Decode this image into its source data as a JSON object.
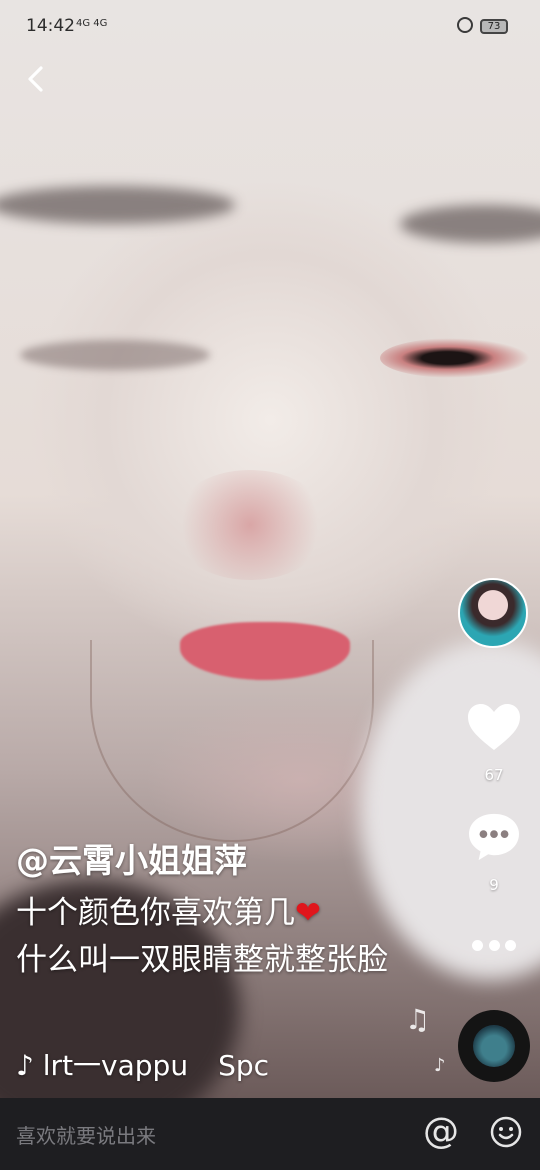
{
  "status_bar": {
    "time": "14:42",
    "signal_text": "4G 4G",
    "battery": "73"
  },
  "author": "@云霄小姐姐萍",
  "description_line1": "十个颜色你喜欢第几",
  "heart_emoji": "❤",
  "description_line2": "什么叫一双眼睛整就整张脸",
  "music": {
    "note": "♪",
    "title": "lrt一vappu",
    "artist": "Spc"
  },
  "actions": {
    "likes": "67",
    "comments": "9"
  },
  "comment_bar": {
    "placeholder": "喜欢就要说出来",
    "at_symbol": "@"
  },
  "icons": [
    "back-icon",
    "lock-icon",
    "heart-icon",
    "comment-icon",
    "more-icon",
    "music-note-icon",
    "music-disc-icon",
    "at-icon",
    "emoji-icon"
  ]
}
